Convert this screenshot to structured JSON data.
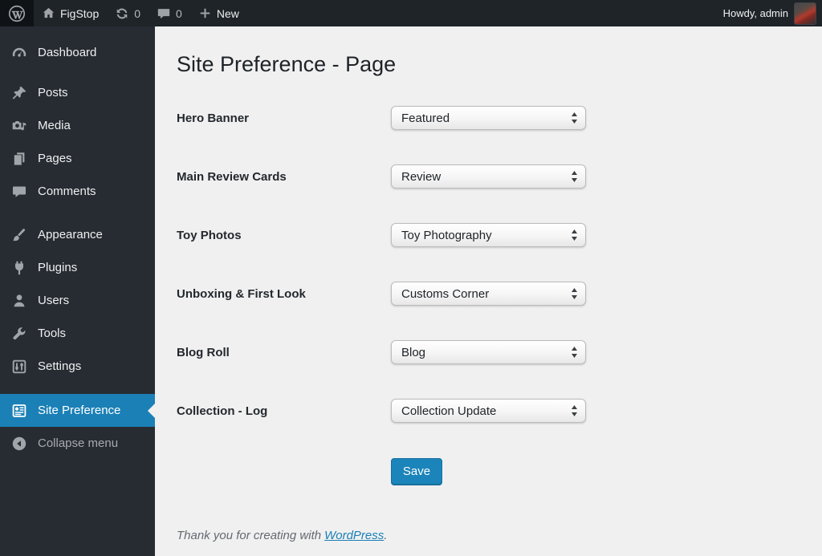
{
  "admin_bar": {
    "site_name": "FigStop",
    "updates_count": "0",
    "comments_count": "0",
    "new_label": "New",
    "howdy": "Howdy, admin"
  },
  "sidebar": {
    "items": [
      {
        "label": "Dashboard",
        "icon": "dashboard-icon"
      },
      {
        "label": "Posts",
        "icon": "pushpin-icon"
      },
      {
        "label": "Media",
        "icon": "camera-icon"
      },
      {
        "label": "Pages",
        "icon": "pages-icon"
      },
      {
        "label": "Comments",
        "icon": "comment-bubble-icon"
      },
      {
        "label": "Appearance",
        "icon": "brush-icon"
      },
      {
        "label": "Plugins",
        "icon": "plug-icon"
      },
      {
        "label": "Users",
        "icon": "person-icon"
      },
      {
        "label": "Tools",
        "icon": "wrench-icon"
      },
      {
        "label": "Settings",
        "icon": "sliders-icon"
      },
      {
        "label": "Site Preference",
        "icon": "site-preference-icon",
        "active": true
      },
      {
        "label": "Collapse menu",
        "icon": "collapse-arrow-icon"
      }
    ]
  },
  "main": {
    "title": "Site Preference - Page",
    "fields": [
      {
        "label": "Hero Banner",
        "value": "Featured"
      },
      {
        "label": "Main Review Cards",
        "value": "Review"
      },
      {
        "label": "Toy Photos",
        "value": "Toy Photography"
      },
      {
        "label": "Unboxing & First Look",
        "value": "Customs Corner"
      },
      {
        "label": "Blog Roll",
        "value": "Blog"
      },
      {
        "label": "Collection - Log",
        "value": "Collection Update"
      }
    ],
    "save_label": "Save",
    "footer": {
      "text": "Thank you for creating with",
      "link": "WordPress",
      "suffix": "."
    }
  },
  "colors": {
    "accent_blue": "#1b80b6",
    "save_button": "#1b84ba",
    "adminbar_bg": "#1f2428",
    "sidebar_bg": "#272c33",
    "content_bg": "#f0f0f1"
  }
}
